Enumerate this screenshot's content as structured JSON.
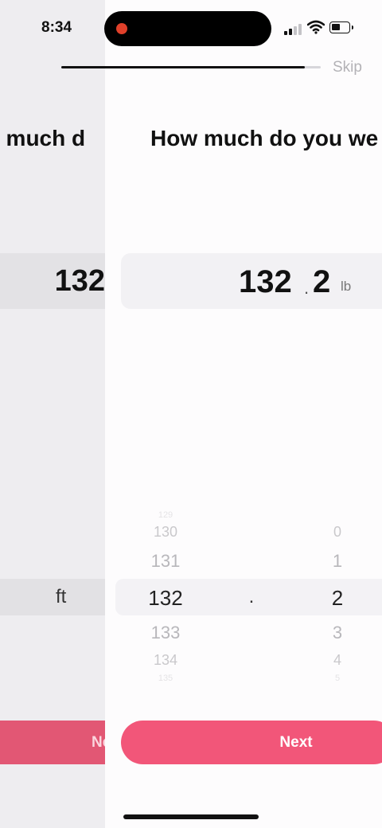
{
  "status_bar": {
    "time": "8:34"
  },
  "header": {
    "skip_label": "Skip",
    "progress": 0.94
  },
  "back_screen": {
    "title": "w much d",
    "value": "132",
    "unit": "ft",
    "next_label": "Ne"
  },
  "question": {
    "title": "How much do you we"
  },
  "value_display": {
    "integer": "132",
    "separator": ".",
    "decimal": "2",
    "unit": "lb"
  },
  "picker": {
    "integer_items": [
      "129",
      "130",
      "131",
      "132",
      "133",
      "134",
      "135"
    ],
    "separator": ".",
    "decimal_items": [
      "",
      "0",
      "1",
      "2",
      "3",
      "4",
      "5"
    ],
    "selected_index": 3
  },
  "next_button": {
    "label": "Next"
  },
  "colors": {
    "accent": "#f25679",
    "text": "#111111",
    "muted": "#b3b2b6"
  }
}
